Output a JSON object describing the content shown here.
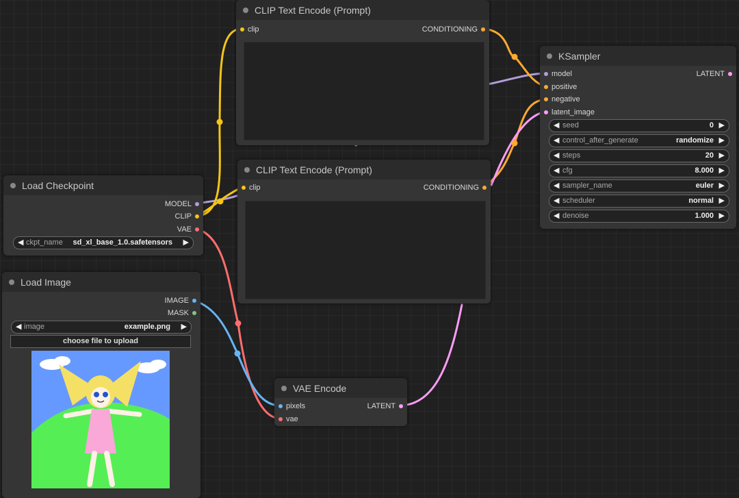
{
  "colors": {
    "clip": "#f5c518",
    "model": "#b39ddb",
    "vae": "#ff6e6e",
    "image": "#64b5f6",
    "mask": "#81c784",
    "latent": "#ff9cf9",
    "conditioning": "#ffa931"
  },
  "nodes": {
    "clip_top": {
      "title": "CLIP Text Encode (Prompt)",
      "input_clip": "clip",
      "output": "CONDITIONING"
    },
    "clip_bottom": {
      "title": "CLIP Text Encode (Prompt)",
      "input_clip": "clip",
      "output": "CONDITIONING"
    },
    "load_checkpoint": {
      "title": "Load Checkpoint",
      "outputs": [
        "MODEL",
        "CLIP",
        "VAE"
      ],
      "widget_label": "ckpt_name",
      "widget_value": "sd_xl_base_1.0.safetensors"
    },
    "load_image": {
      "title": "Load Image",
      "outputs": [
        "IMAGE",
        "MASK"
      ],
      "widget_label": "image",
      "widget_value": "example.png",
      "upload_label": "choose file to upload"
    },
    "vae_encode": {
      "title": "VAE Encode",
      "inputs": [
        "pixels",
        "vae"
      ],
      "output": "LATENT"
    },
    "ksampler": {
      "title": "KSampler",
      "inputs": [
        "model",
        "positive",
        "negative",
        "latent_image"
      ],
      "output": "LATENT",
      "widgets": [
        {
          "label": "seed",
          "value": "0"
        },
        {
          "label": "control_after_generate",
          "value": "randomize"
        },
        {
          "label": "steps",
          "value": "20"
        },
        {
          "label": "cfg",
          "value": "8.000"
        },
        {
          "label": "sampler_name",
          "value": "euler"
        },
        {
          "label": "scheduler",
          "value": "normal"
        },
        {
          "label": "denoise",
          "value": "1.000"
        }
      ]
    }
  },
  "icons": {
    "arrow_left": "◀",
    "arrow_right": "▶"
  }
}
